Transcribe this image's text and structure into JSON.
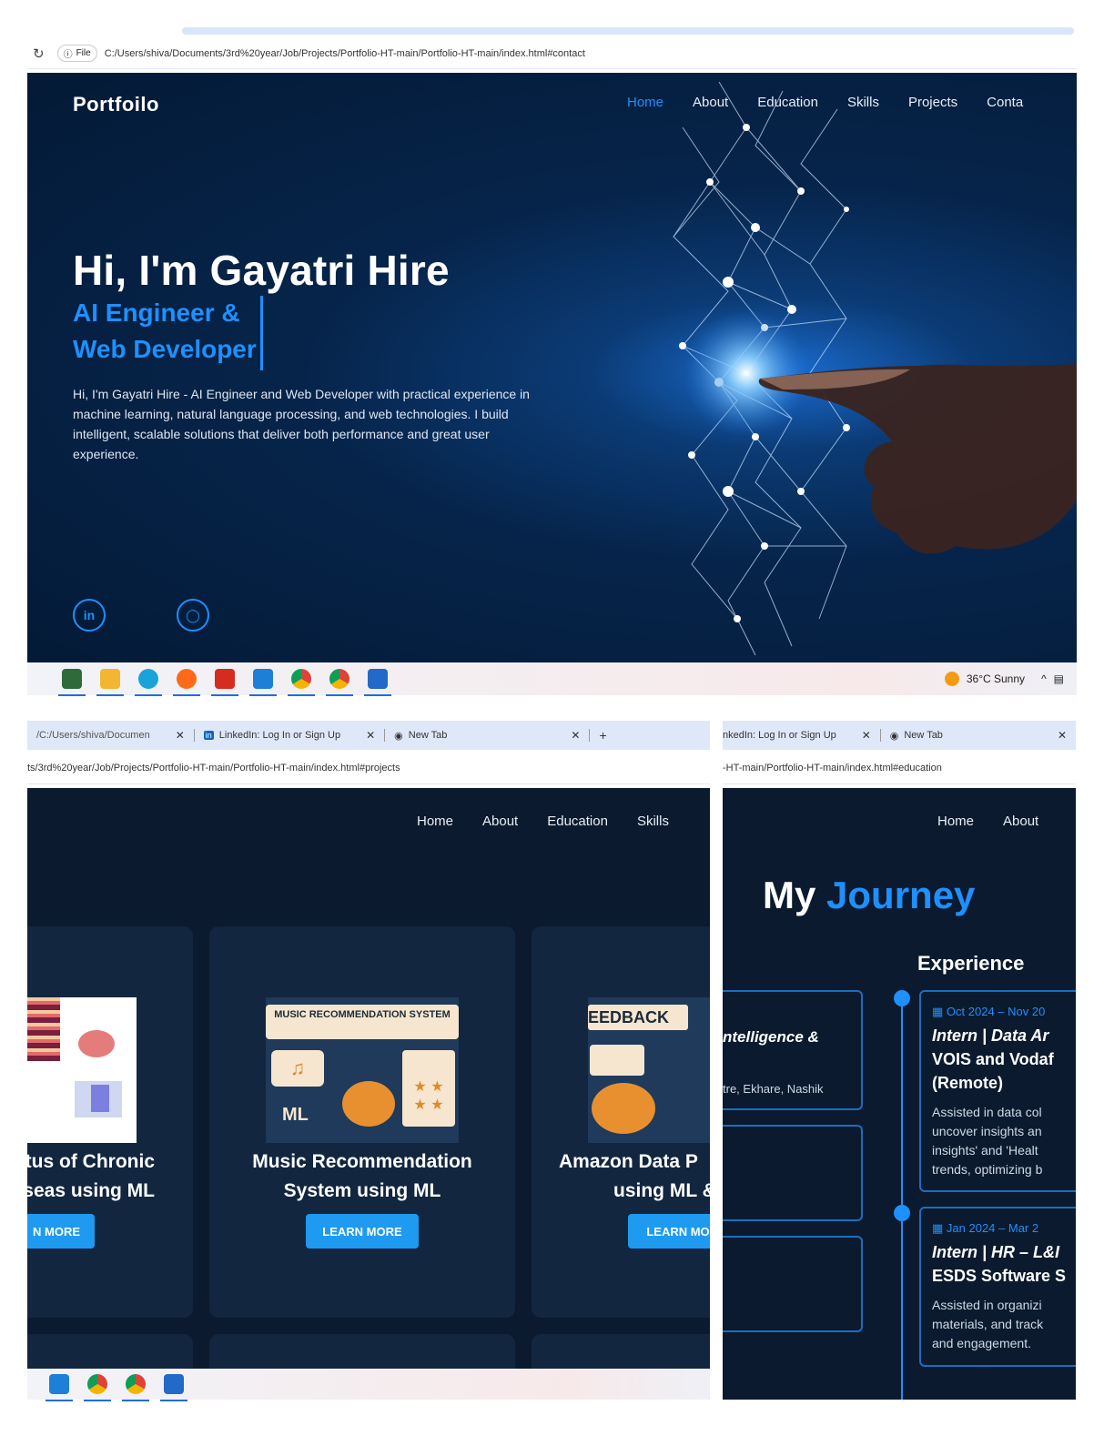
{
  "top_window": {
    "address": "C:/Users/shiva/Documents/3rd%20year/Job/Projects/Portfolio-HT-main/Portfolio-HT-main/index.html#contact",
    "file_label": "File",
    "brand": "Portfoilo",
    "nav": [
      "Home",
      "About",
      "Education",
      "Skills",
      "Projects",
      "Conta"
    ],
    "active_nav": "Home",
    "heading": "Hi, I'm Gayatri Hire",
    "subtitle_line1": "AI Engineer &",
    "subtitle_line2": "Web Developer",
    "description": "Hi, I'm Gayatri Hire - AI Engineer and Web Developer with practical experience in machine learning, natural language processing, and web technologies. I build intelligent, scalable solutions that deliver both performance and great user experience.",
    "social": [
      {
        "name": "linkedin-icon",
        "label": "in"
      },
      {
        "name": "github-icon",
        "label": "◯"
      }
    ],
    "weather": "36°C  Sunny",
    "accent": "#1e90ff"
  },
  "left_window": {
    "tabs": [
      "/C:/Users/shiva/Documen",
      "LinkedIn: Log In or Sign Up",
      "New Tab"
    ],
    "new_tab": "+",
    "address": "ts/3rd%20year/Job/Projects/Portfolio-HT-main/Portfolio-HT-main/index.html#projects",
    "nav": [
      "Home",
      "About",
      "Education",
      "Skills"
    ],
    "cards": [
      {
        "title_line1": "tus of Chronic",
        "title_line2": "seas using ML",
        "button": "N MORE"
      },
      {
        "title_line1": "Music Recommendation",
        "title_line2": "System using ML",
        "button": "LEARN MORE",
        "image_label": "MUSIC RECOMMENDATION SYSTEM",
        "image_ml": "ML"
      },
      {
        "title_line1": "Amazon Data P",
        "title_line2": "using ML &",
        "button": "LEARN MO",
        "image_label": "EEDBACK"
      }
    ]
  },
  "right_window": {
    "tabs": [
      "nkedIn: Log In or Sign Up",
      "New Tab"
    ],
    "address": "-HT-main/Portfolio-HT-main/index.html#education",
    "nav": [
      "Home",
      "About"
    ],
    "title_white": "My",
    "title_blue": "Journey",
    "experience_heading": "Experience",
    "left_box_text1": "ntelligence &",
    "left_box_text2": "tre, Ekhare, Nashik",
    "entries": [
      {
        "date": "Oct 2024 – Nov 20",
        "role": "Intern | Data Ar",
        "org_line1": "VOIS and Vodaf",
        "org_line2": "(Remote)",
        "body": [
          "Assisted in data col",
          "uncover insights an",
          "insights' and 'Healt",
          "trends, optimizing b"
        ]
      },
      {
        "date": "Jan 2024 – Mar 2",
        "role": "Intern | HR – L&I",
        "org_line1": "ESDS Software S",
        "org_line2": "",
        "body": [
          "Assisted in organizi",
          "materials, and track",
          "and engagement."
        ]
      }
    ]
  }
}
